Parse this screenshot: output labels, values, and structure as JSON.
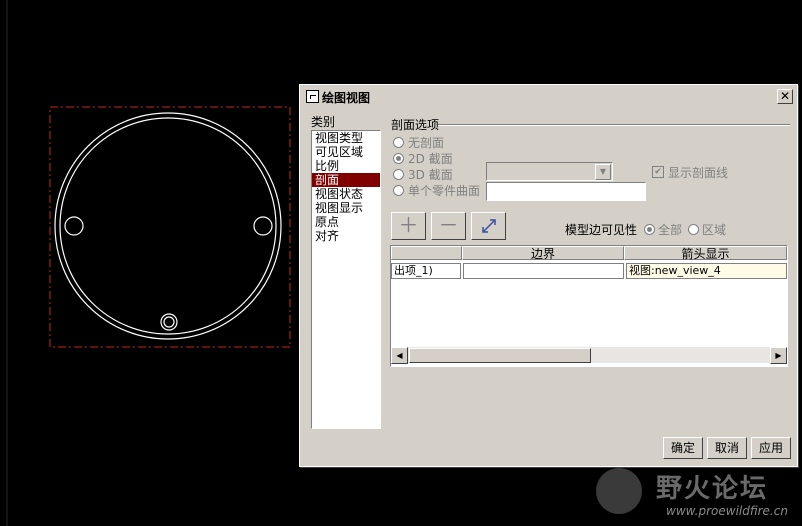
{
  "dialog": {
    "title": "绘图视图",
    "close": "✕",
    "category_label": "类别",
    "categories": [
      "视图类型",
      "可见区域",
      "比例",
      "剖面",
      "视图状态",
      "视图显示",
      "原点",
      "对齐"
    ],
    "selected_category": "剖面",
    "section_group": "剖面选项",
    "radios": {
      "none": "无剖面",
      "twod": "2D 截面",
      "threed": "3D 截面",
      "single": "单个零件曲面"
    },
    "show_section_lines": "显示剖面线",
    "edge_visibility_label": "模型边可见性",
    "edge_all": "全部",
    "edge_region": "区域",
    "grid": {
      "headers": [
        "",
        "边界",
        "箭头显示"
      ],
      "row": [
        "出项_1)",
        "",
        "视图:new_view_4"
      ]
    },
    "buttons": {
      "ok": "确定",
      "cancel": "取消",
      "apply": "应用"
    },
    "toolbar_icons": {
      "add": "＋",
      "remove": "－"
    }
  },
  "watermark": {
    "text": "野火论坛",
    "url": "www.proewildfire.cn"
  }
}
